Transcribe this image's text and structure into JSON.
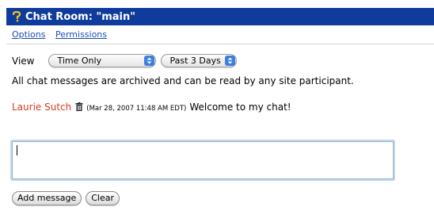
{
  "header": {
    "title": "Chat Room: \"main\"",
    "icon": "help-icon",
    "background": "#0f3c9c"
  },
  "nav": {
    "options_label": "Options",
    "permissions_label": "Permissions"
  },
  "view": {
    "label": "View",
    "mode_selected": "Time Only",
    "range_selected": "Past 3 Days"
  },
  "archive_note": "All chat messages are archived and can be read by any site participant.",
  "messages": [
    {
      "author": "Laurie Sutch",
      "timestamp": "(Mar 28, 2007 11:48 AM EDT)",
      "text": "Welcome to my chat!",
      "author_color": "#d63b1f"
    }
  ],
  "composer": {
    "value": ""
  },
  "actions": {
    "add_label": "Add message",
    "clear_label": "Clear"
  }
}
